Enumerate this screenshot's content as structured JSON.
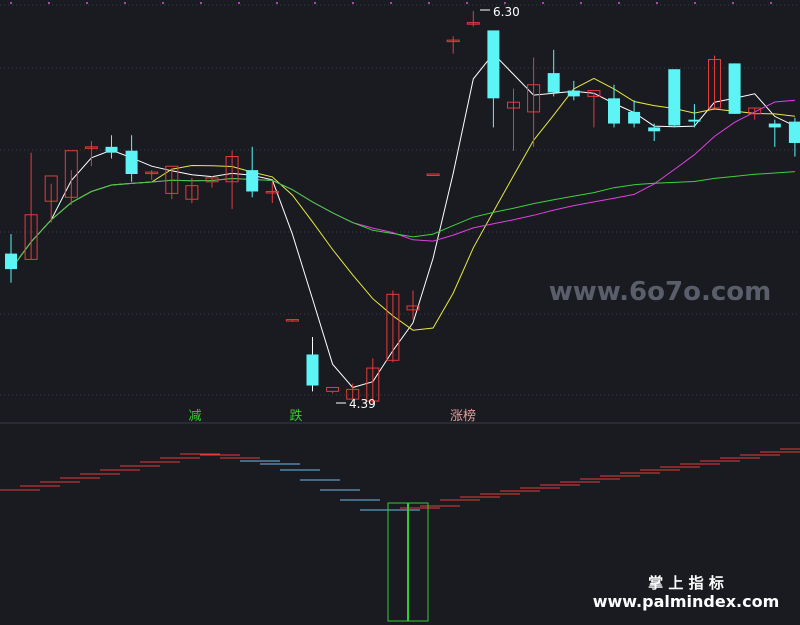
{
  "chart_data": {
    "type": "candlestick",
    "price_range": [
      4.0,
      6.5
    ],
    "grid": true,
    "candles": [
      {
        "o": 5.05,
        "h": 5.15,
        "l": 4.9,
        "c": 4.97
      },
      {
        "o": 5.02,
        "h": 5.57,
        "l": 5.02,
        "c": 5.25
      },
      {
        "o": 5.32,
        "h": 5.41,
        "l": 5.21,
        "c": 5.45
      },
      {
        "o": 5.34,
        "h": 5.48,
        "l": 5.3,
        "c": 5.58
      },
      {
        "o": 5.6,
        "h": 5.63,
        "l": 5.5,
        "c": 5.6
      },
      {
        "o": 5.6,
        "h": 5.66,
        "l": 5.54,
        "c": 5.57
      },
      {
        "o": 5.58,
        "h": 5.66,
        "l": 5.42,
        "c": 5.46
      },
      {
        "o": 5.47,
        "h": 5.48,
        "l": 5.43,
        "c": 5.47
      },
      {
        "o": 5.36,
        "h": 5.49,
        "l": 5.33,
        "c": 5.5
      },
      {
        "o": 5.33,
        "h": 5.44,
        "l": 5.31,
        "c": 5.4
      },
      {
        "o": 5.42,
        "h": 5.45,
        "l": 5.39,
        "c": 5.44
      },
      {
        "o": 5.42,
        "h": 5.58,
        "l": 5.28,
        "c": 5.55
      },
      {
        "o": 5.48,
        "h": 5.6,
        "l": 5.34,
        "c": 5.37
      },
      {
        "o": 5.37,
        "h": 5.42,
        "l": 5.31,
        "c": 5.37
      }
    ],
    "candles2": [
      {
        "o": 4.71,
        "h": 4.71,
        "l": 4.7,
        "c": 4.71
      },
      {
        "o": 4.53,
        "h": 4.62,
        "l": 4.34,
        "c": 4.37
      },
      {
        "o": 4.34,
        "h": 4.34,
        "l": 4.33,
        "c": 4.36
      },
      {
        "o": 4.3,
        "h": 4.38,
        "l": 4.3,
        "c": 4.35
      },
      {
        "o": 4.29,
        "h": 4.51,
        "l": 4.28,
        "c": 4.46
      },
      {
        "o": 4.5,
        "h": 4.86,
        "l": 4.49,
        "c": 4.84
      },
      {
        "o": 4.76,
        "h": 4.86,
        "l": 4.71,
        "c": 4.78
      },
      {
        "o": 5.46,
        "h": 5.46,
        "l": 5.46,
        "c": 5.46
      },
      {
        "o": 6.15,
        "h": 6.17,
        "l": 6.08,
        "c": 6.15
      },
      {
        "o": 6.24,
        "h": 6.3,
        "l": 6.22,
        "c": 6.24
      },
      {
        "o": 6.2,
        "h": 6.2,
        "l": 5.7,
        "c": 5.85
      },
      {
        "o": 5.8,
        "h": 5.9,
        "l": 5.58,
        "c": 5.83
      },
      {
        "o": 5.78,
        "h": 6.06,
        "l": 5.6,
        "c": 5.92
      },
      {
        "o": 5.98,
        "h": 6.1,
        "l": 5.86,
        "c": 5.88
      },
      {
        "o": 5.89,
        "h": 5.94,
        "l": 5.84,
        "c": 5.86
      },
      {
        "o": 5.86,
        "h": 5.88,
        "l": 5.7,
        "c": 5.89
      },
      {
        "o": 5.85,
        "h": 5.92,
        "l": 5.7,
        "c": 5.72
      },
      {
        "o": 5.78,
        "h": 5.84,
        "l": 5.7,
        "c": 5.72
      },
      {
        "o": 5.7,
        "h": 5.72,
        "l": 5.63,
        "c": 5.68
      },
      {
        "o": 6.0,
        "h": 6.0,
        "l": 5.7,
        "c": 5.71
      },
      {
        "o": 5.74,
        "h": 5.82,
        "l": 5.7,
        "c": 5.73
      },
      {
        "o": 5.8,
        "h": 6.07,
        "l": 5.8,
        "c": 6.05
      },
      {
        "o": 6.03,
        "h": 6.03,
        "l": 5.77,
        "c": 5.77
      },
      {
        "o": 5.77,
        "h": 5.8,
        "l": 5.74,
        "c": 5.8
      },
      {
        "o": 5.72,
        "h": 5.74,
        "l": 5.6,
        "c": 5.7
      },
      {
        "o": 5.73,
        "h": 5.75,
        "l": 5.55,
        "c": 5.62
      }
    ],
    "price_labels": [
      {
        "text": "6.30",
        "value": 6.3
      },
      {
        "text": "4.39",
        "value": 4.39
      }
    ],
    "signals": [
      {
        "text": "减",
        "color": "#33cc33"
      },
      {
        "text": "跌",
        "color": "#33cc33"
      },
      {
        "text": "涨榜",
        "color": "#e89a9a"
      }
    ],
    "series": [
      {
        "color": "#ffffff"
      },
      {
        "color": "#e8e840"
      },
      {
        "color": "#e040e0"
      },
      {
        "color": "#40d040"
      }
    ]
  },
  "watermarks": {
    "main": "www.6o7o.com",
    "brand_cn": "掌 上 指 标",
    "brand_url": "www.palmindex.com"
  },
  "colors": {
    "up": "#e53b3b",
    "down": "#5cf4f4",
    "background": "#191b21",
    "grid": "#3a3d48"
  }
}
